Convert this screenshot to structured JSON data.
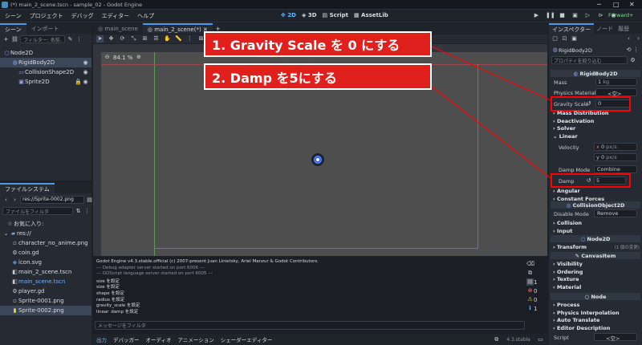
{
  "window_title": "(*) main_2_scene.tscn - sample_02 - Godot Engine",
  "menu": [
    "シーン",
    "プロジェクト",
    "デバッグ",
    "エディター",
    "ヘルプ"
  ],
  "workspaces": {
    "two_d": "2D",
    "three_d": "3D",
    "script": "Script",
    "assetlib": "AssetLib"
  },
  "renderer": "Forward+",
  "scene_dock": {
    "tabs": [
      "シーン",
      "インポート"
    ],
    "filter_placeholder": "フィルター: 名前、t",
    "nodes": [
      "Node2D",
      "RigidBody2D",
      "CollisionShape2D",
      "Sprite2D"
    ]
  },
  "filesystem": {
    "title": "ファイルシステム",
    "path": "res://Sprite-0002.png",
    "filter_placeholder": "ファイルをフィルタ",
    "favorites": "お気に入り:",
    "root": "res://",
    "files": [
      "character_no_anime.png",
      "coin.gd",
      "icon.svg",
      "main_2_scene.tscn",
      "main_scene.tscn",
      "player.gd",
      "Sprite-0001.png",
      "Sprite-0002.png"
    ]
  },
  "editor_tabs": [
    "main_scene",
    "main_2_scene(*)"
  ],
  "zoom": "84.1 %",
  "output": {
    "lines": [
      "Godot Engine v4.3.stable.official (c) 2007-present Juan Linietsky, Ariel Manzur & Godot Contributors.",
      "--- Debug adapter server started on port 6006 ---",
      "--- GDScript language server started on port 6005 ---",
      "size を設定",
      "size を設定",
      "shape を設定",
      "radius を設定",
      "gravity_scale を設定",
      "linear_damp を設定"
    ],
    "filter_placeholder": "メッセージをフィルタ",
    "counts": [
      "1",
      "0",
      "0",
      "1"
    ]
  },
  "bottom_tabs": [
    "出力",
    "デバッガー",
    "オーディオ",
    "アニメーション",
    "シェーダーエディター"
  ],
  "version": "4.3.stable",
  "inspector": {
    "tabs": [
      "インスペクター",
      "ノード",
      "履歴"
    ],
    "node": "RigidBody2D",
    "filter_placeholder": "プロパティを絞り込む",
    "section_rigid": "RigidBody2D",
    "mass_label": "Mass",
    "mass_value": "1",
    "mass_unit": "kg",
    "physics_material_label": "Physics Material",
    "physics_material_value": "<空>",
    "gravity_label": "Gravity Scale",
    "gravity_value": "0",
    "cats1": [
      "Mass Distribution",
      "Deactivation",
      "Solver",
      "Linear"
    ],
    "velocity_label": "Velocity",
    "vx": "0",
    "vy": "0",
    "vunit": "px/s",
    "damp_mode_label": "Damp Mode",
    "damp_mode_value": "Combine",
    "damp_label": "Damp",
    "damp_value": "5",
    "cats2": [
      "Angular",
      "Constant Forces"
    ],
    "section_collision": "CollisionObject2D",
    "disable_mode_label": "Disable Mode",
    "disable_mode_value": "Remove",
    "cats3": [
      "Collision",
      "Input"
    ],
    "section_node2d": "Node2D",
    "transform": "Transform",
    "transform_note": "(1 個の変更)",
    "section_canvas": "CanvasItem",
    "cats4": [
      "Visibility",
      "Ordering",
      "Texture",
      "Material"
    ],
    "section_node": "Node",
    "cats5": [
      "Process",
      "Physics Interpolation",
      "Auto Translate",
      "Editor Description"
    ],
    "script_label": "Script",
    "script_value": "<空>"
  },
  "annotations": {
    "callout1": "1. Gravity Scale を 0 にする",
    "callout2": "2. Damp を5にする"
  },
  "colors": {
    "accent": "#4c9bf0",
    "highlight": "#ff0000"
  }
}
